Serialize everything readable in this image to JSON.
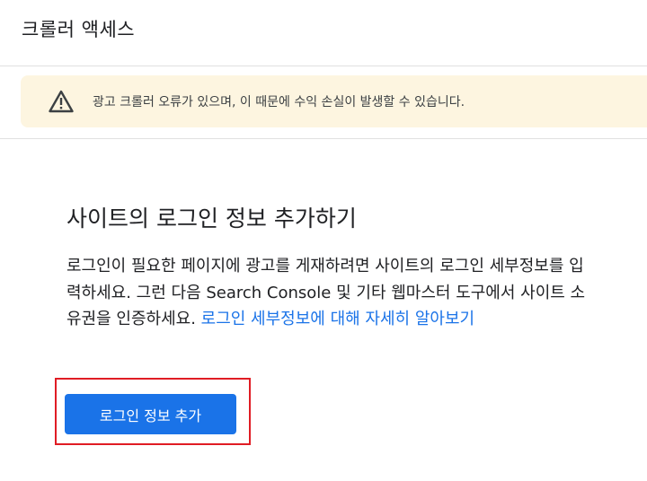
{
  "header": {
    "title": "크롤러 액세스"
  },
  "warning": {
    "icon": "warning-triangle-icon",
    "message": "광고 크롤러 오류가 있으며, 이 때문에 수익 손실이 발생할 수 있습니다."
  },
  "section": {
    "title": "사이트의 로그인 정보 추가하기",
    "description": "로그인이 필요한 페이지에 광고를 게재하려면 사이트의 로그인 세부정보를 입력하세요. 그런 다음 Search Console 및 기타 웹마스터 도구에서 사이트 소유권을 인증하세요. ",
    "learn_more_link": "로그인 세부정보에 대해 자세히 알아보기",
    "button_label": "로그인 정보 추가"
  },
  "colors": {
    "accent": "#1a73e8",
    "warning_bg": "#fdf5e0",
    "highlight": "#e01c24"
  }
}
